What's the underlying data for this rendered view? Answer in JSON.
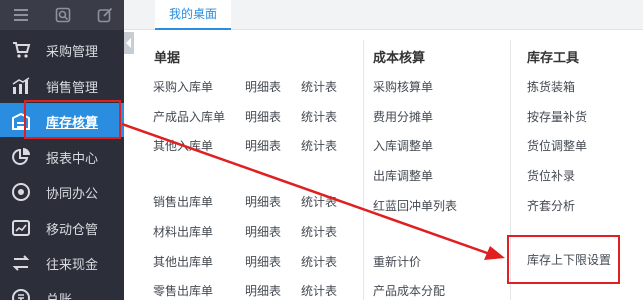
{
  "workspace_tab": "我的桌面",
  "sidebar": {
    "items": [
      {
        "label": "采购管理"
      },
      {
        "label": "销售管理"
      },
      {
        "label": "库存核算"
      },
      {
        "label": "报表中心"
      },
      {
        "label": "协同办公"
      },
      {
        "label": "移动仓管"
      },
      {
        "label": "往来现金"
      },
      {
        "label": "总账"
      }
    ]
  },
  "documents": {
    "heading": "单据",
    "rows": [
      {
        "name": "采购入库单",
        "detail": "明细表",
        "stats": "统计表"
      },
      {
        "name": "产成品入库单",
        "detail": "明细表",
        "stats": "统计表"
      },
      {
        "name": "其他入库单",
        "detail": "明细表",
        "stats": "统计表"
      },
      {
        "name": "销售出库单",
        "detail": "明细表",
        "stats": "统计表"
      },
      {
        "name": "材料出库单",
        "detail": "明细表",
        "stats": "统计表"
      },
      {
        "name": "其他出库单",
        "detail": "明细表",
        "stats": "统计表"
      },
      {
        "name": "零售出库单",
        "detail": "明细表",
        "stats": "统计表"
      }
    ]
  },
  "cost_accounting": {
    "heading": "成本核算",
    "items": [
      "采购核算单",
      "费用分摊单",
      "入库调整单",
      "出库调整单",
      "红蓝回冲单列表",
      "重新计价",
      "产品成本分配"
    ]
  },
  "inventory_tools": {
    "heading": "库存工具",
    "items": [
      "拣货装箱",
      "按存量补货",
      "货位调整单",
      "货位补录",
      "齐套分析",
      "库存上下限设置"
    ]
  },
  "colors": {
    "sidebar_bg": "#2c2f3a",
    "accent": "#2a8ddf",
    "annotation_red": "#e02020"
  }
}
